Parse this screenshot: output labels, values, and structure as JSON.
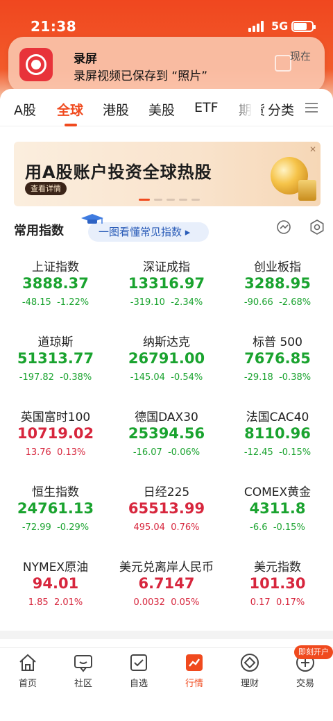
{
  "status_bar": {
    "time": "21:38",
    "network": "5G"
  },
  "notification": {
    "title": "录屏",
    "body": "录屏视频已保存到 “照片”",
    "time": "现在"
  },
  "tabs": [
    "A股",
    "全球",
    "港股",
    "美股",
    "ETF",
    "期货",
    "分类"
  ],
  "active_tab": "全球",
  "banner": {
    "title": "用A股账户投资全球热股",
    "button": "查看详情",
    "close": "✕"
  },
  "section": {
    "title": "常用指数",
    "guide": "一图看懂常见指数 ▸"
  },
  "indices": [
    {
      "name": "上证指数",
      "price": "3888.37",
      "change": "-48.15",
      "pct": "-1.22%",
      "dir": "down"
    },
    {
      "name": "深证成指",
      "price": "13316.97",
      "change": "-319.10",
      "pct": "-2.34%",
      "dir": "down"
    },
    {
      "name": "创业板指",
      "price": "3288.95",
      "change": "-90.66",
      "pct": "-2.68%",
      "dir": "down"
    },
    {
      "name": "道琼斯",
      "price": "51313.77",
      "change": "-197.82",
      "pct": "-0.38%",
      "dir": "down"
    },
    {
      "name": "纳斯达克",
      "price": "26791.00",
      "change": "-145.04",
      "pct": "-0.54%",
      "dir": "down"
    },
    {
      "name": "标普 500",
      "price": "7676.85",
      "change": "-29.18",
      "pct": "-0.38%",
      "dir": "down"
    },
    {
      "name": "英国富时100",
      "price": "10719.02",
      "change": "13.76",
      "pct": "0.13%",
      "dir": "up"
    },
    {
      "name": "德国DAX30",
      "price": "25394.56",
      "change": "-16.07",
      "pct": "-0.06%",
      "dir": "down"
    },
    {
      "name": "法国CAC40",
      "price": "8110.96",
      "change": "-12.45",
      "pct": "-0.15%",
      "dir": "down"
    },
    {
      "name": "恒生指数",
      "price": "24761.13",
      "change": "-72.99",
      "pct": "-0.29%",
      "dir": "down"
    },
    {
      "name": "日经225",
      "price": "65513.99",
      "change": "495.04",
      "pct": "0.76%",
      "dir": "up"
    },
    {
      "name": "COMEX黄金",
      "price": "4311.8",
      "change": "-6.6",
      "pct": "-0.15%",
      "dir": "down"
    },
    {
      "name": "NYMEX原油",
      "price": "94.01",
      "change": "1.85",
      "pct": "2.01%",
      "dir": "up"
    },
    {
      "name": "美元兑离岸人民币",
      "price": "6.7147",
      "change": "0.0032",
      "pct": "0.05%",
      "dir": "up"
    },
    {
      "name": "美元指数",
      "price": "101.30",
      "change": "0.17",
      "pct": "0.17%",
      "dir": "up"
    }
  ],
  "bottom_nav": [
    {
      "label": "首页",
      "icon": "home-icon"
    },
    {
      "label": "社区",
      "icon": "chat-icon"
    },
    {
      "label": "自选",
      "icon": "checklist-icon"
    },
    {
      "label": "行情",
      "icon": "chart-icon"
    },
    {
      "label": "理财",
      "icon": "wealth-icon"
    },
    {
      "label": "交易",
      "icon": "trade-icon"
    }
  ],
  "active_nav": "行情",
  "open_account_badge": "即刻开户",
  "colors": {
    "accent": "#f04a1e",
    "up": "#d7263d",
    "down": "#1aa32f"
  }
}
